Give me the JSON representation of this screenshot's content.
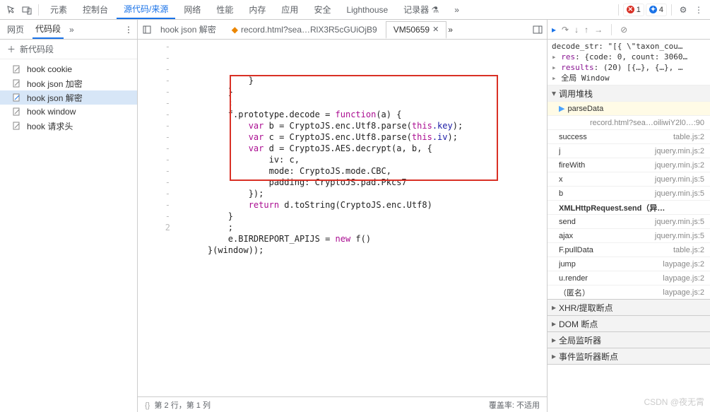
{
  "toolbar": {
    "tabs": [
      "元素",
      "控制台",
      "源代码/来源",
      "网络",
      "性能",
      "内存",
      "应用",
      "安全",
      "Lighthouse",
      "记录器"
    ],
    "active": 2,
    "rec_badge": "⬨",
    "err_count": "1",
    "msg_count": "4"
  },
  "left": {
    "tabs": [
      "网页",
      "代码段"
    ],
    "active": 1,
    "new_label": "新代码段",
    "snippets": [
      "hook cookie",
      "hook json 加密",
      "hook json 解密",
      "hook window",
      "hook 请求头"
    ],
    "selected": 2
  },
  "files": {
    "tabs": [
      {
        "label": "hook json 解密",
        "kind": "snippet"
      },
      {
        "label": "record.html?sea…RlX3R5cGUiOjB9",
        "kind": "file"
      },
      {
        "label": "VM50659",
        "kind": "vm",
        "active": true
      }
    ]
  },
  "code": {
    "gutter": [
      "-",
      "-",
      "-",
      "-",
      "-",
      "-",
      "-",
      "-",
      "-",
      "-",
      "-",
      "-",
      "-",
      "-",
      "-",
      "-",
      "",
      "2"
    ],
    "lines": [
      "            }",
      "        }",
      "        ;",
      "        f.prototype.decode = function(a) {",
      "            var b = CryptoJS.enc.Utf8.parse(this.key);",
      "            var c = CryptoJS.enc.Utf8.parse(this.iv);",
      "            var d = CryptoJS.AES.decrypt(a, b, {",
      "                iv: c,",
      "                mode: CryptoJS.mode.CBC,",
      "                padding: CryptoJS.pad.Pkcs7",
      "            });",
      "            return d.toString(CryptoJS.enc.Utf8)",
      "        }",
      "        ;",
      "        e.BIRDREPORT_APIJS = new f()",
      "    }(window));",
      ""
    ]
  },
  "status": {
    "pos": "第 2 行，第 1 列",
    "cov_label": "覆盖率:",
    "cov_value": "不适用"
  },
  "scope": {
    "lines": [
      {
        "pre": "  ",
        "text": "decode_str: \"[{ \\\"taxon_cou…"
      },
      {
        "pre": "▸ ",
        "key": "res",
        "text": ": {code: 0, count: 3060…"
      },
      {
        "pre": "▸ ",
        "key": "results",
        "text": ": (20) [{…}, {…}, …"
      },
      {
        "pre": "▸ ",
        "text": "全局                         Window"
      }
    ]
  },
  "sections": {
    "callstack": "调用堆栈",
    "xhr": "XHR/提取断点",
    "dom": "DOM 断点",
    "global": "全局监听器",
    "event": "事件监听器断点"
  },
  "callstack": [
    {
      "name": "parseData",
      "loc": "",
      "hl": true,
      "arrow": true
    },
    {
      "name": "",
      "loc": "record.html?sea…oiliwiY2l0…:90",
      "sub": true
    },
    {
      "name": "success",
      "loc": "table.js:2"
    },
    {
      "name": "j",
      "loc": "jquery.min.js:2"
    },
    {
      "name": "fireWith",
      "loc": "jquery.min.js:2"
    },
    {
      "name": "x",
      "loc": "jquery.min.js:5"
    },
    {
      "name": "b",
      "loc": "jquery.min.js:5"
    },
    {
      "name": "XMLHttpRequest.send（异…",
      "loc": "",
      "bold": true
    },
    {
      "name": "send",
      "loc": "jquery.min.js:5"
    },
    {
      "name": "ajax",
      "loc": "jquery.min.js:5"
    },
    {
      "name": "F.pullData",
      "loc": "table.js:2"
    },
    {
      "name": "jump",
      "loc": "laypage.js:2"
    },
    {
      "name": "u.render",
      "loc": "laypage.js:2"
    },
    {
      "name": "（匿名）",
      "loc": "laypage.js:2"
    }
  ],
  "watermark": "CSDN @夜无霄"
}
